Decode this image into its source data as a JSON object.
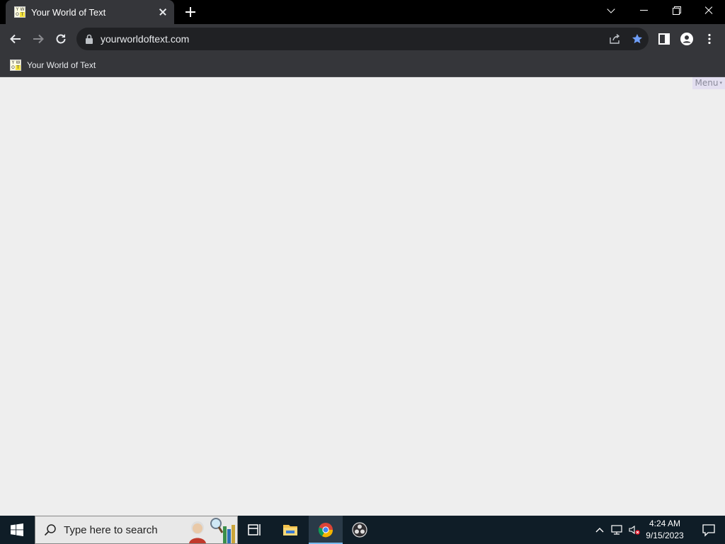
{
  "browser": {
    "tab": {
      "title": "Your World of Text",
      "favicon": "yourworldoftext-favicon"
    },
    "address_bar": {
      "url": "yourworldoftext.com"
    },
    "bookmarks": [
      {
        "label": "Your World of Text"
      }
    ]
  },
  "page": {
    "menu_label": "Menu",
    "menu_arrow": "▾",
    "background": "#eeeeee"
  },
  "taskbar": {
    "search_placeholder": "Type here to search",
    "clock": {
      "time": "4:24 AM",
      "date": "9/15/2023"
    },
    "apps": [
      "task-view-icon",
      "file-explorer-icon",
      "chrome-icon",
      "obs-icon"
    ]
  }
}
